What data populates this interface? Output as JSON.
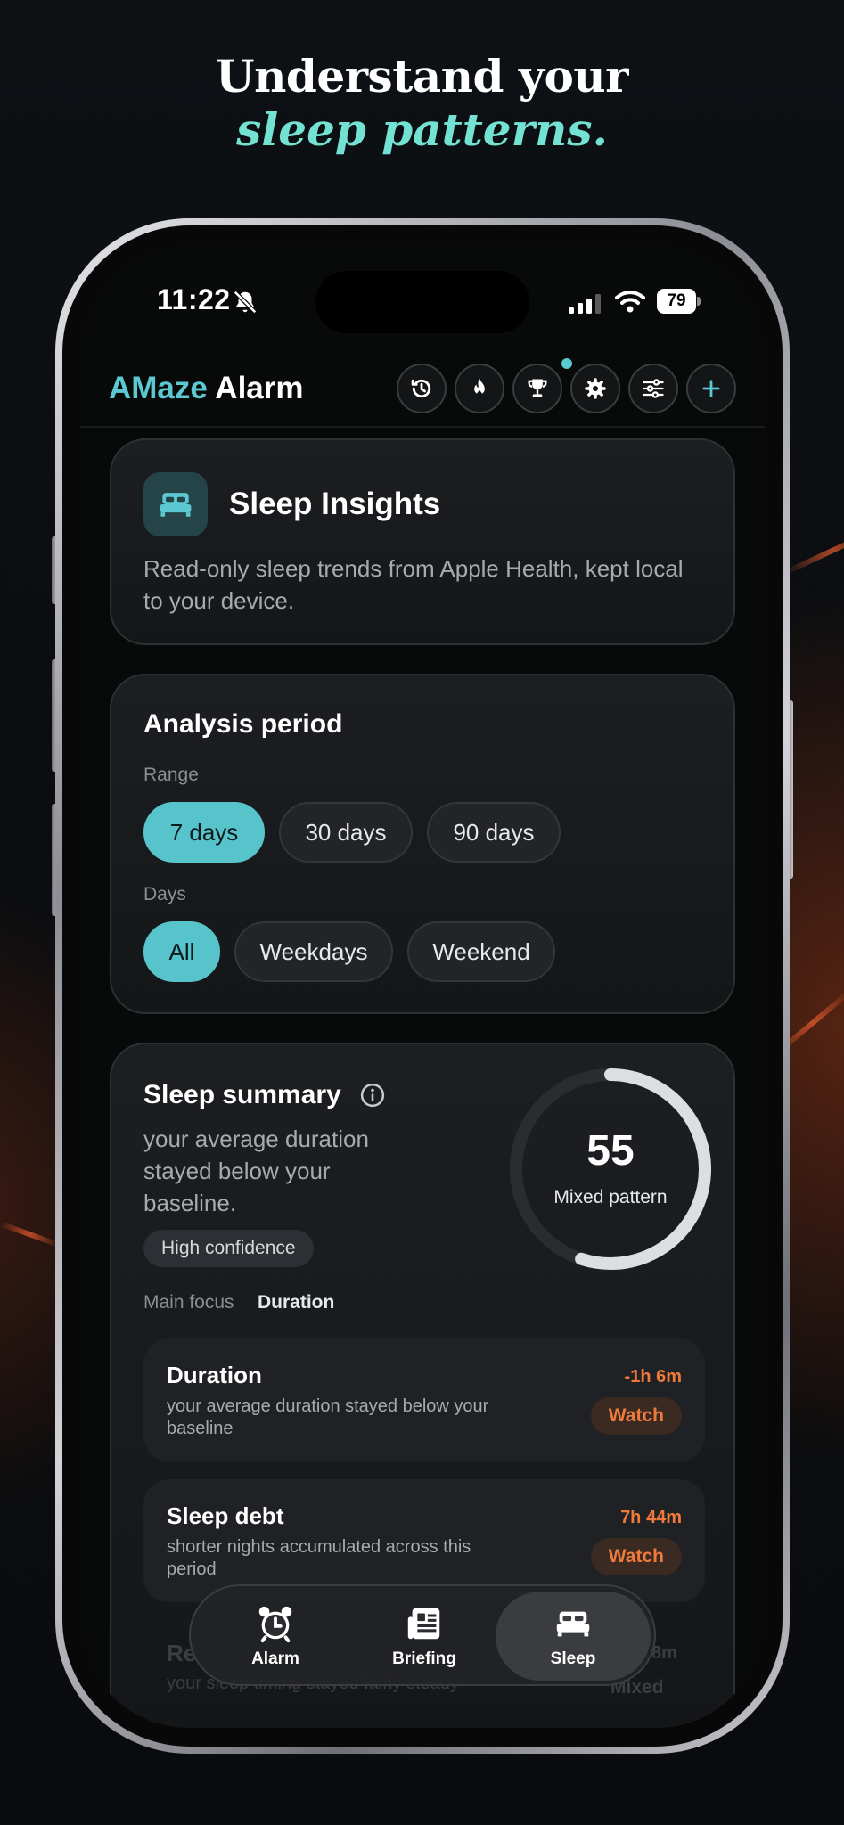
{
  "headline": {
    "line1": "Understand your",
    "line2": "sleep patterns."
  },
  "status_bar": {
    "time": "11:22",
    "battery": "79",
    "icons": [
      "bell-slash-icon",
      "cellular-signal-icon",
      "wifi-icon",
      "battery-icon"
    ]
  },
  "app": {
    "title_accent": "AMaze",
    "title_rest": " Alarm",
    "header_buttons": [
      "history-icon",
      "streak-flame-icon",
      "trophy-icon",
      "gear-icon",
      "sliders-icon",
      "plus-icon"
    ]
  },
  "insights": {
    "icon": "bed-icon",
    "title": "Sleep Insights",
    "description": "Read-only sleep trends from Apple Health, kept local to your device."
  },
  "analysis": {
    "title": "Analysis period",
    "range_label": "Range",
    "range_options": [
      "7 days",
      "30 days",
      "90 days"
    ],
    "range_selected": "7 days",
    "days_label": "Days",
    "days_options": [
      "All",
      "Weekdays",
      "Weekend"
    ],
    "days_selected": "All"
  },
  "summary": {
    "title": "Sleep summary",
    "description": "your average duration stayed below your baseline.",
    "confidence": "High confidence",
    "focus_label": "Main focus",
    "focus_value": "Duration",
    "score": "55",
    "score_fraction": 0.55,
    "score_label": "Mixed pattern"
  },
  "metrics": [
    {
      "name": "Duration",
      "desc": "your average duration stayed below your baseline",
      "value": "-1h 6m",
      "badge": "Watch"
    },
    {
      "name": "Sleep debt",
      "desc": "shorter nights accumulated across this period",
      "value": "7h 44m",
      "badge": "Watch"
    }
  ],
  "ghost_metric": {
    "name": "Re",
    "desc": "your sleep timing stayed fairly steady",
    "value": "8m",
    "badge": "Mixed"
  },
  "tabs": [
    {
      "label": "Alarm",
      "icon": "alarm-clock-icon"
    },
    {
      "label": "Briefing",
      "icon": "newspaper-icon"
    },
    {
      "label": "Sleep",
      "icon": "bed-icon"
    }
  ],
  "active_tab": "Sleep",
  "colors": {
    "accent": "#57c4cc",
    "title_accent": "#5cc8d2",
    "headline_accent": "#74e2d2",
    "warning": "#f07a3c"
  }
}
